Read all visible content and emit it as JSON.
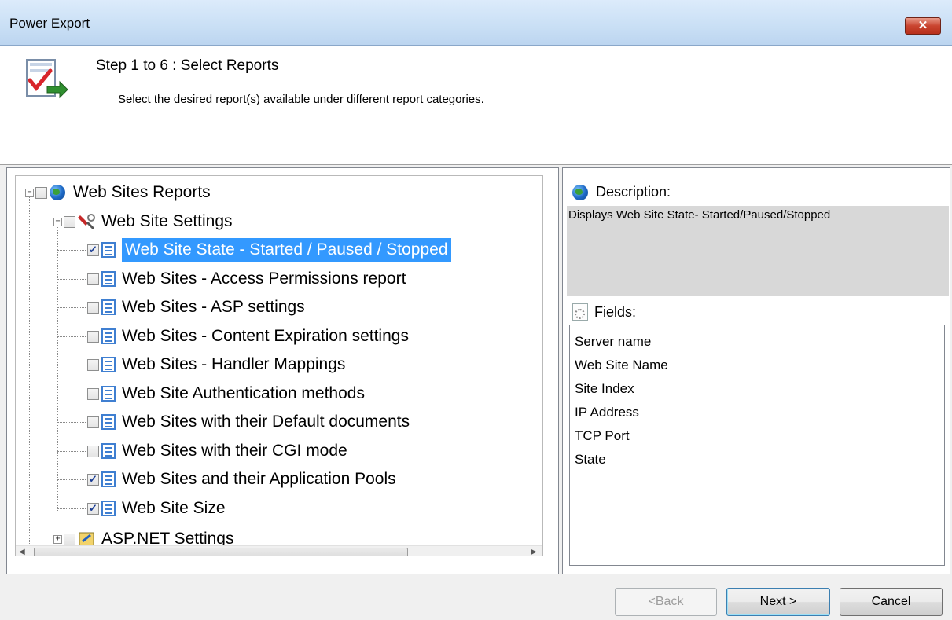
{
  "window": {
    "title": "Power Export",
    "close_label": "✕"
  },
  "header": {
    "step_title": "Step 1 to 6 : Select Reports",
    "step_subtitle": "Select the desired report(s) available under different report categories."
  },
  "tree": {
    "root": {
      "label": "Web Sites Reports",
      "checked": false,
      "expanded": true
    },
    "group": {
      "label": "Web Site Settings",
      "checked": false,
      "expanded": true
    },
    "items": [
      {
        "label": "Web Site State - Started / Paused / Stopped",
        "checked": true,
        "selected": true
      },
      {
        "label": "Web Sites - Access Permissions report",
        "checked": false
      },
      {
        "label": "Web Sites - ASP settings",
        "checked": false
      },
      {
        "label": "Web Sites - Content Expiration settings",
        "checked": false
      },
      {
        "label": "Web Sites - Handler Mappings",
        "checked": false
      },
      {
        "label": "Web Site Authentication methods",
        "checked": false
      },
      {
        "label": "Web Sites with their Default documents",
        "checked": false
      },
      {
        "label": "Web Sites with their CGI mode",
        "checked": false
      },
      {
        "label": "Web Sites and their Application Pools",
        "checked": true
      },
      {
        "label": "Web Site Size",
        "checked": true
      }
    ],
    "next_group": {
      "label": "ASP.NET Settings",
      "checked": false,
      "expanded": false
    }
  },
  "details": {
    "description_label": "Description:",
    "description_text": "Displays Web Site State- Started/Paused/Stopped",
    "fields_label": "Fields:",
    "fields": [
      "Server name",
      "Web Site Name",
      "Site Index",
      "IP Address",
      "TCP Port",
      "State"
    ]
  },
  "buttons": {
    "back": "<Back",
    "next": "Next >",
    "cancel": "Cancel"
  },
  "colors": {
    "selection": "#3399ff",
    "titlebar": "#c9dff5",
    "close": "#c9442f"
  }
}
